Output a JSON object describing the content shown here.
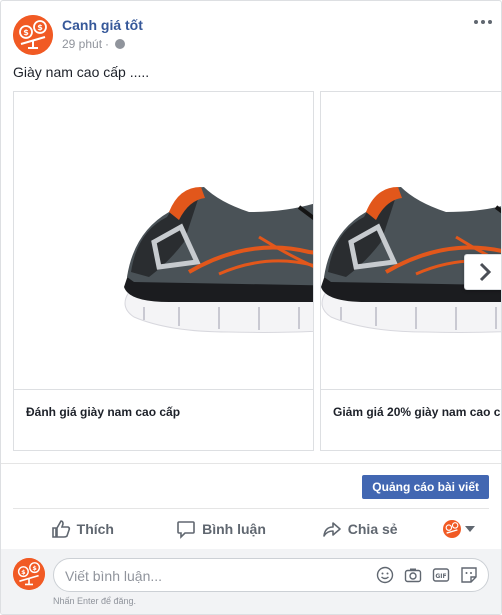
{
  "post": {
    "page_name": "Canh giá tốt",
    "timestamp": "29 phút",
    "separator": "·",
    "text": "Giày nam cao cấp .....",
    "brand_color": "#f15a24"
  },
  "carousel": {
    "cards": [
      {
        "caption": "Đánh giá giày nam cao cấp",
        "image": "running-shoe"
      },
      {
        "caption": "Giảm giá 20% giày nam cao c",
        "image": "running-shoe"
      }
    ],
    "next_icon": "chevron-right-icon"
  },
  "boost": {
    "label": "Quảng cáo bài viết",
    "color": "#4267b2"
  },
  "actions": {
    "like": "Thích",
    "comment": "Bình luận",
    "share": "Chia sẻ"
  },
  "comment": {
    "placeholder": "Viết bình luận...",
    "hint": "Nhấn Enter để đăng.",
    "tools": [
      "emoji-icon",
      "camera-icon",
      "gif-icon",
      "sticker-icon"
    ]
  }
}
